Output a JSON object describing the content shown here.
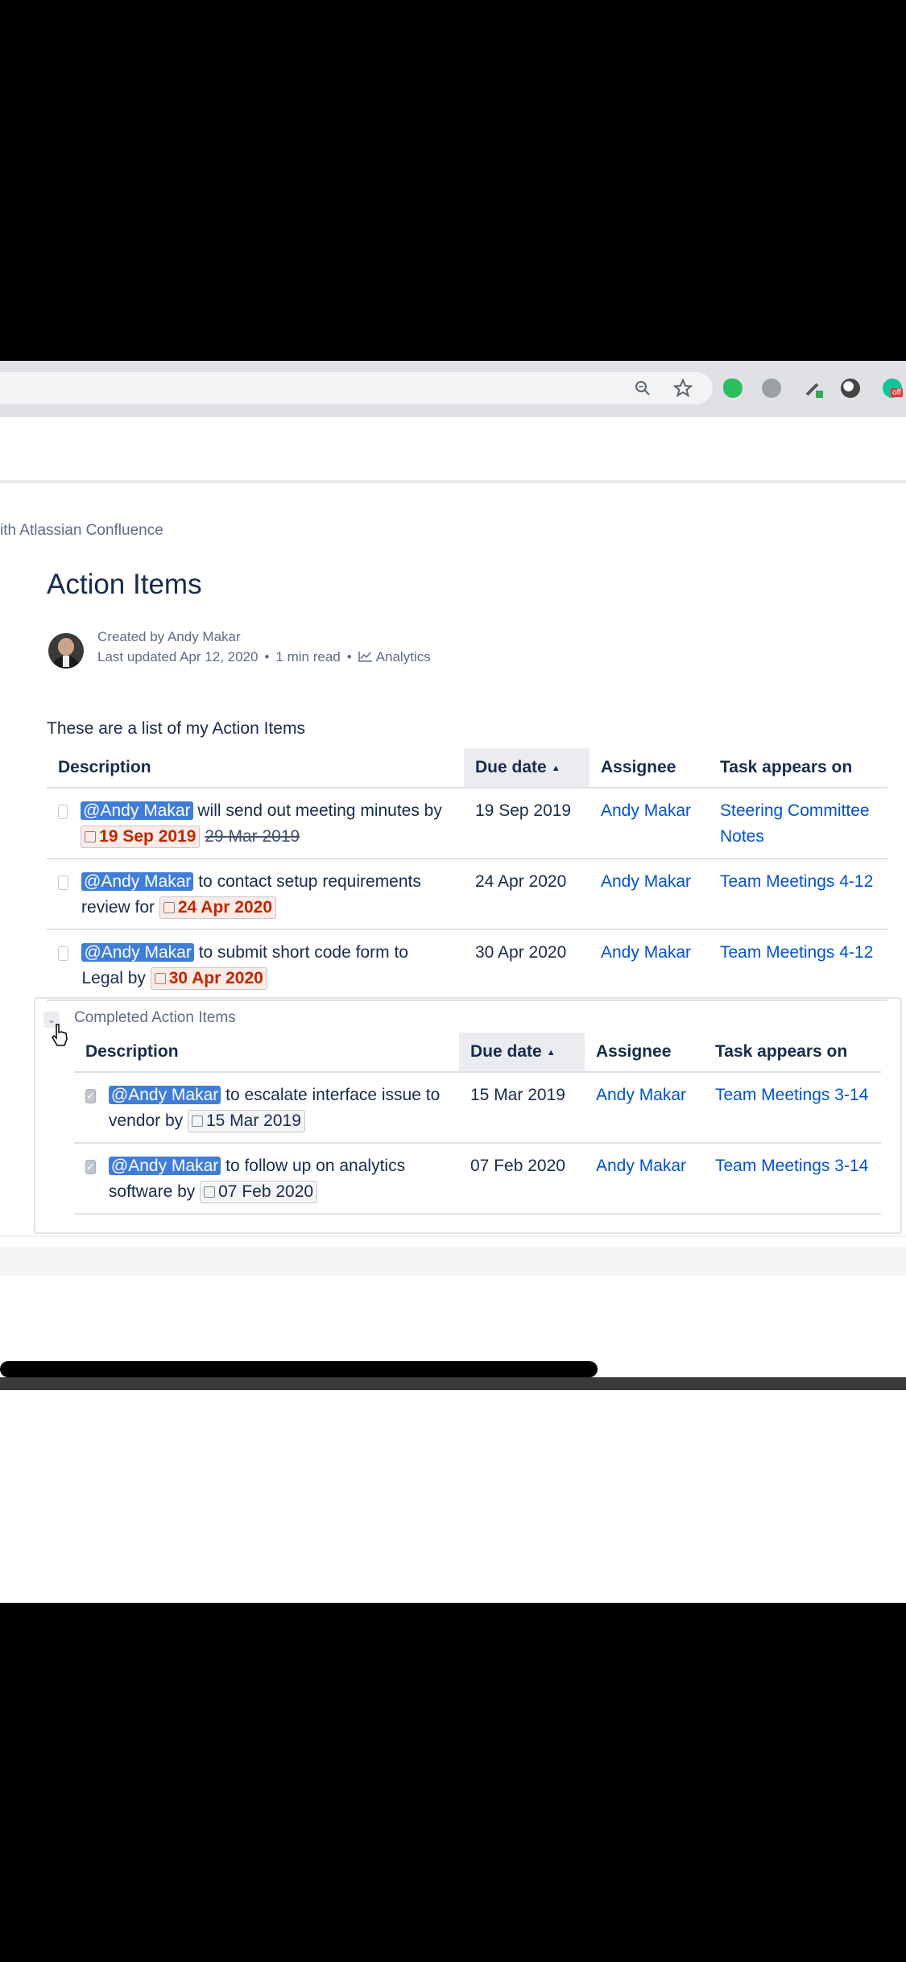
{
  "breadcrumb": "ith Atlassian Confluence",
  "page": {
    "title": "Action Items",
    "created_by": "Created by Andy Makar",
    "last_updated": "Last updated Apr 12, 2020",
    "read_time": "1 min read",
    "analytics": "Analytics",
    "intro": "These are a list of my Action Items"
  },
  "tasks_table": {
    "headers": {
      "description": "Description",
      "due_date": "Due date",
      "assignee": "Assignee",
      "appears_on": "Task appears on"
    },
    "rows": [
      {
        "mention": "@Andy Makar",
        "text": " will send out meeting minutes by ",
        "date": "19 Sep 2019",
        "old_date": "29 Mar 2019",
        "due": "19 Sep 2019",
        "assignee": "Andy Makar",
        "page": "Steering Committee Notes"
      },
      {
        "mention": "@Andy Makar",
        "text": " to contact setup requirements review for ",
        "date": "24 Apr 2020",
        "due": "24 Apr 2020",
        "assignee": "Andy Makar",
        "page": "Team Meetings 4-12"
      },
      {
        "mention": "@Andy Makar",
        "text": " to submit short code form to Legal by ",
        "date": "30 Apr 2020",
        "due": "30 Apr 2020",
        "assignee": "Andy Makar",
        "page": "Team Meetings 4-12"
      }
    ]
  },
  "completed": {
    "title": "Completed Action Items",
    "headers": {
      "description": "Description",
      "due_date": "Due date",
      "assignee": "Assignee",
      "appears_on": "Task appears on"
    },
    "rows": [
      {
        "mention": "@Andy Makar",
        "text": " to escalate interface issue to vendor by ",
        "date": "15 Mar 2019",
        "due": "15 Mar 2019",
        "assignee": "Andy Makar",
        "page": "Team Meetings 3-14"
      },
      {
        "mention": "@Andy Makar",
        "text": " to follow up on analytics software by ",
        "date": "07 Feb 2020",
        "due": "07 Feb 2020",
        "assignee": "Andy Makar",
        "page": "Team Meetings 3-14"
      }
    ]
  },
  "toolbar": {
    "icons": [
      "zoom-icon",
      "star-icon",
      "evernote-icon",
      "extension-icon",
      "eyedropper-icon",
      "extension-icon",
      "grammarly-icon"
    ],
    "badge": "off"
  },
  "colors": {
    "mention": "#0052cc",
    "overdue": "#bf2600",
    "link": "#0052cc"
  }
}
